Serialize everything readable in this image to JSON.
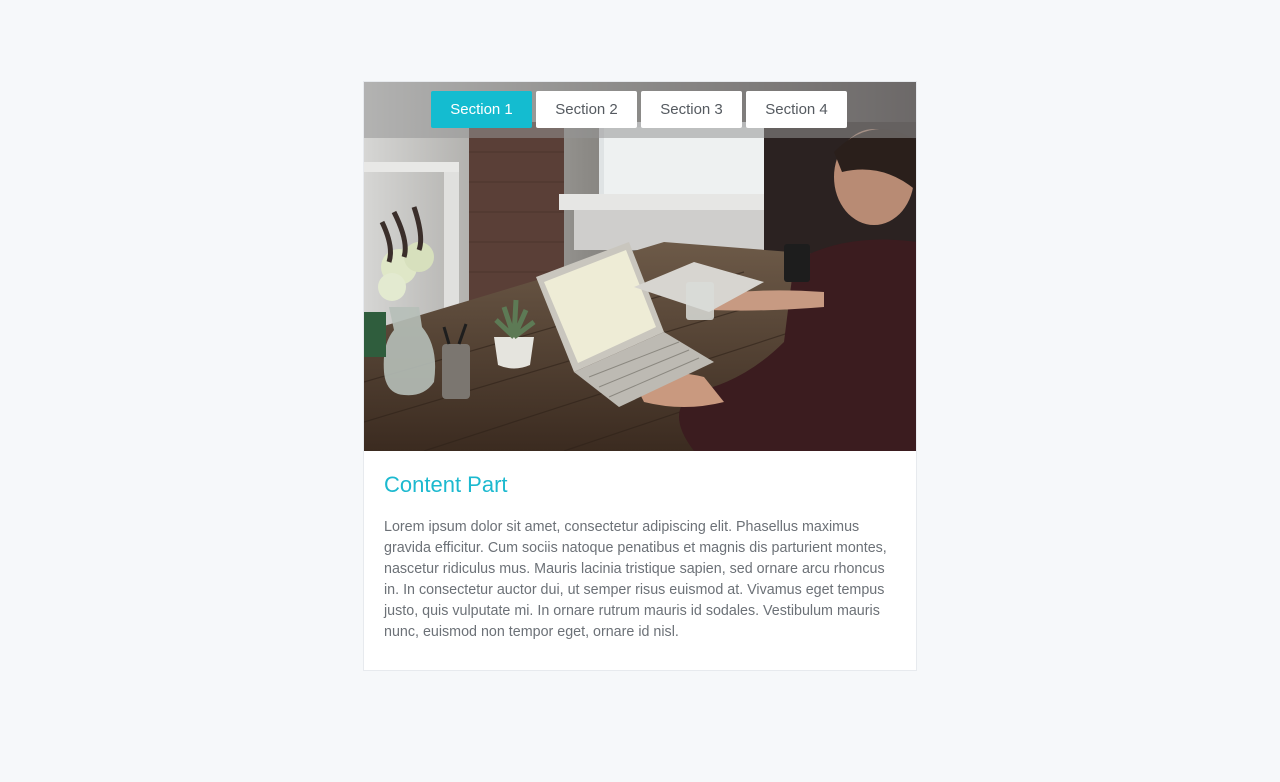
{
  "tabs": [
    {
      "label": "Section 1",
      "active": true
    },
    {
      "label": "Section 2",
      "active": false
    },
    {
      "label": "Section 3",
      "active": false
    },
    {
      "label": "Section 4",
      "active": false
    }
  ],
  "content": {
    "heading": "Content Part",
    "body": "Lorem ipsum dolor sit amet, consectetur adipiscing elit. Phasellus maximus gravida efficitur. Cum sociis natoque penatibus et magnis dis parturient montes, nascetur ridiculus mus. Mauris lacinia tristique sapien, sed ornare arcu rhoncus in. In consectetur auctor dui, ut semper risus euismod at. Vivamus eget tempus justo, quis vulputate mi. In ornare rutrum mauris id sodales. Vestibulum mauris nunc, euismod non tempor eget, ornare id nisl."
  },
  "colors": {
    "accent": "#14bcd0",
    "heading": "#1cb9cf",
    "background": "#f6f8fa"
  }
}
